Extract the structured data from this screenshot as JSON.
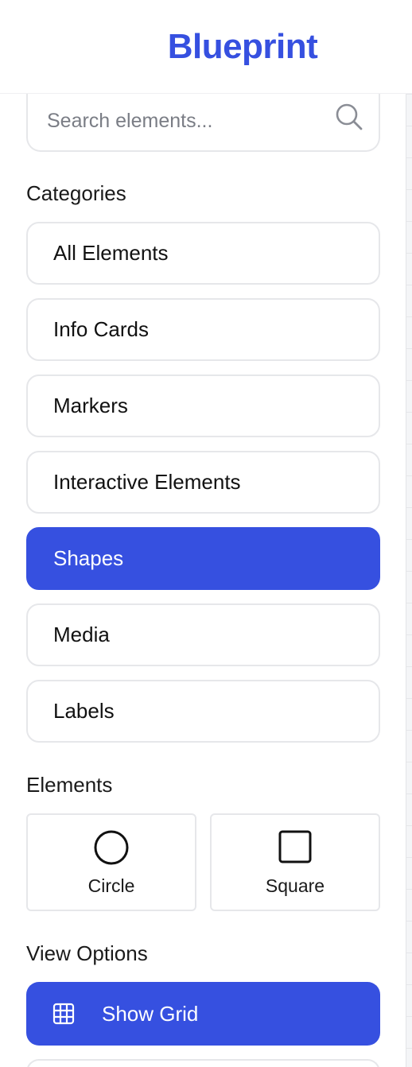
{
  "header": {
    "brand": "Blueprint"
  },
  "search": {
    "placeholder": "Search elements...",
    "icon": "search-icon"
  },
  "categories": {
    "title": "Categories",
    "items": [
      {
        "label": "All Elements",
        "active": false
      },
      {
        "label": "Info Cards",
        "active": false
      },
      {
        "label": "Markers",
        "active": false
      },
      {
        "label": "Interactive Elements",
        "active": false
      },
      {
        "label": "Shapes",
        "active": true
      },
      {
        "label": "Media",
        "active": false
      },
      {
        "label": "Labels",
        "active": false
      }
    ]
  },
  "elements": {
    "title": "Elements",
    "items": [
      {
        "label": "Circle",
        "icon": "circle-icon"
      },
      {
        "label": "Square",
        "icon": "square-icon"
      }
    ]
  },
  "view_options": {
    "title": "View Options",
    "show_grid_label": "Show Grid",
    "show_grid_icon": "grid-icon"
  },
  "colors": {
    "accent": "#3650e0",
    "border": "#e6e7ea",
    "text": "#111111"
  }
}
